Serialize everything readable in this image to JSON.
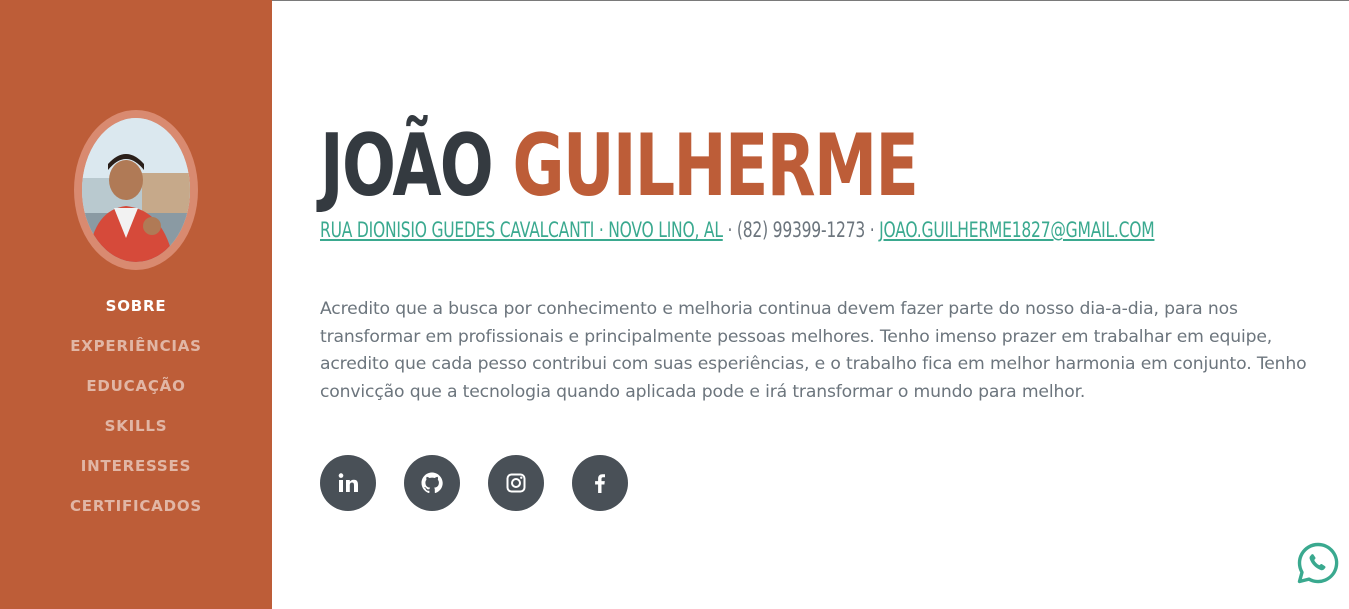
{
  "profile": {
    "first_name": "JOÃO",
    "last_name": "GUILHERME",
    "address": "RUA DIONISIO GUEDES CAVALCANTI · NOVO LINO, AL",
    "phone": "(82) 99399-1273",
    "email": "JOAO.GUILHERME1827@GMAIL.COM",
    "separator": " · ",
    "about": "Acredito que a busca por conhecimento e melhoria continua devem fazer parte do nosso dia-a-dia, para nos transformar em profissionais e principalmente pessoas melhores. Tenho imenso prazer em trabalhar em equipe, acredito que cada pesso contribui com suas esperiências, e o trabalho fica em melhor harmonia em conjunto. Tenho convicção que a tecnologia quando aplicada pode e irá transformar o mundo para melhor."
  },
  "sidebar": {
    "items": [
      {
        "label": "SOBRE",
        "active": true
      },
      {
        "label": "EXPERIÊNCIAS",
        "active": false
      },
      {
        "label": "EDUCAÇÃO",
        "active": false
      },
      {
        "label": "SKILLS",
        "active": false
      },
      {
        "label": "INTERESSES",
        "active": false
      },
      {
        "label": "CERTIFICADOS",
        "active": false
      }
    ]
  },
  "social": [
    {
      "icon": "linkedin-icon"
    },
    {
      "icon": "github-icon"
    },
    {
      "icon": "instagram-icon"
    },
    {
      "icon": "facebook-icon"
    }
  ],
  "colors": {
    "sidebar_bg": "#bd5d38",
    "accent": "#bd5d38",
    "link": "#3aa98f",
    "heading": "#343a40",
    "body_text": "#6c757d",
    "social_bg": "#495057",
    "whatsapp": "#3aa98f"
  }
}
